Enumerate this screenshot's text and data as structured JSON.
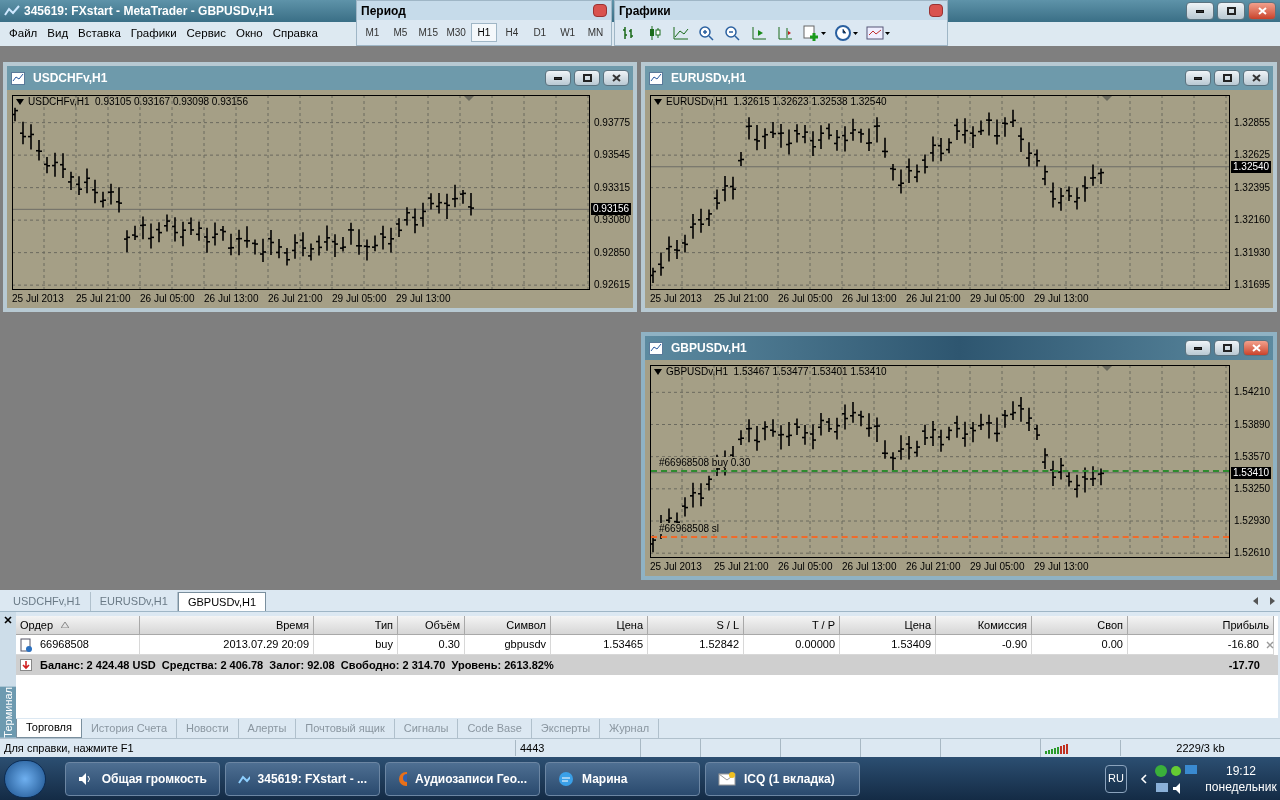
{
  "window": {
    "title": "345619: FXstart - MetaTrader - GBPUSDv,H1"
  },
  "menu": [
    "Файл",
    "Вид",
    "Вставка",
    "Графики",
    "Сервис",
    "Окно",
    "Справка"
  ],
  "period_toolbar": {
    "title": "Период",
    "buttons": [
      {
        "label": "M1",
        "selected": false
      },
      {
        "label": "M5",
        "selected": false
      },
      {
        "label": "M15",
        "selected": false
      },
      {
        "label": "M30",
        "selected": false
      },
      {
        "label": "H1",
        "selected": true
      },
      {
        "label": "H4",
        "selected": false
      },
      {
        "label": "D1",
        "selected": false
      },
      {
        "label": "W1",
        "selected": false
      },
      {
        "label": "MN",
        "selected": false
      }
    ]
  },
  "charts_toolbar": {
    "title": "Графики"
  },
  "chart_windows": [
    {
      "title": "USDCHFv,H1",
      "active": false,
      "header": "USDCHFv,H1  0.93105 0.93167 0.93098 0.93156",
      "price_labels": [
        "0.93775",
        "0.93545",
        "0.93315",
        "0.93080",
        "0.92850",
        "0.92615"
      ],
      "last_price": "0.93156",
      "time_labels": [
        "25 Jul 2013",
        "25 Jul 21:00",
        "26 Jul 05:00",
        "26 Jul 13:00",
        "26 Jul 21:00",
        "29 Jul 05:00",
        "29 Jul 13:00"
      ]
    },
    {
      "title": "EURUSDv,H1",
      "active": false,
      "header": "EURUSDv,H1  1.32615 1.32623 1.32538 1.32540",
      "price_labels": [
        "1.32855",
        "1.32625",
        "1.32395",
        "1.32160",
        "1.31930",
        "1.31695"
      ],
      "last_price": "1.32540",
      "time_labels": [
        "25 Jul 2013",
        "25 Jul 21:00",
        "26 Jul 05:00",
        "26 Jul 13:00",
        "26 Jul 21:00",
        "29 Jul 05:00",
        "29 Jul 13:00"
      ]
    },
    {
      "title": "GBPUSDv,H1",
      "active": true,
      "header": "GBPUSDv,H1  1.53467 1.53477 1.53401 1.53410",
      "price_labels": [
        "1.54210",
        "1.53890",
        "1.53570",
        "1.53250",
        "1.52930",
        "1.52610"
      ],
      "last_price": "1.53410",
      "time_labels": [
        "25 Jul 2013",
        "25 Jul 21:00",
        "26 Jul 05:00",
        "26 Jul 13:00",
        "26 Jul 21:00",
        "29 Jul 05:00",
        "29 Jul 13:00"
      ],
      "order_lines": [
        {
          "kind": "buy",
          "label": "#66968508 buy 0.30",
          "color": "#2e8b2e"
        },
        {
          "kind": "sl",
          "label": "#66968508 sl",
          "color": "#f06a2a"
        }
      ]
    }
  ],
  "doc_tabs": [
    {
      "label": "USDCHFv,H1",
      "selected": false
    },
    {
      "label": "EURUSDv,H1",
      "selected": false
    },
    {
      "label": "GBPUSDv,H1",
      "selected": true
    }
  ],
  "terminal": {
    "side_label": "Терминал",
    "columns": [
      "Ордер",
      "Время",
      "Тип",
      "Объём",
      "Символ",
      "Цена",
      "S / L",
      "T / P",
      "Цена",
      "Комиссия",
      "Своп",
      "Прибыль"
    ],
    "rows": [
      [
        "66968508",
        "2013.07.29 20:09",
        "buy",
        "0.30",
        "gbpusdv",
        "1.53465",
        "1.52842",
        "0.00000",
        "1.53409",
        "-0.90",
        "0.00",
        "-16.80"
      ]
    ],
    "summary": {
      "text": "Баланс: 2 424.48 USD  Средства: 2 406.78  Залог: 92.08  Свободно: 2 314.70  Уровень: 2613.82%",
      "profit": "-17.70"
    },
    "tabs": [
      {
        "label": "Торговля",
        "selected": true
      },
      {
        "label": "История Счета",
        "selected": false
      },
      {
        "label": "Новости",
        "selected": false
      },
      {
        "label": "Алерты",
        "selected": false
      },
      {
        "label": "Почтовый ящик",
        "selected": false
      },
      {
        "label": "Сигналы",
        "selected": false
      },
      {
        "label": "Code Base",
        "selected": false
      },
      {
        "label": "Эксперты",
        "selected": false
      },
      {
        "label": "Журнал",
        "selected": false
      }
    ]
  },
  "status_bar": {
    "help": "Для справки, нажмите F1",
    "count": "4443",
    "traffic": "2229/3 kb"
  },
  "taskbar": {
    "items": [
      {
        "kind": "volume",
        "label": "Общая громкость"
      },
      {
        "kind": "app",
        "label": "345619: FXstart - ..."
      },
      {
        "kind": "browser",
        "label": "Аудиозаписи Гео..."
      },
      {
        "kind": "chat",
        "label": "Марина"
      },
      {
        "kind": "mail",
        "label": "ICQ (1 вкладка)"
      }
    ],
    "language": "RU",
    "time": "19:12",
    "day": "понедельник"
  }
}
